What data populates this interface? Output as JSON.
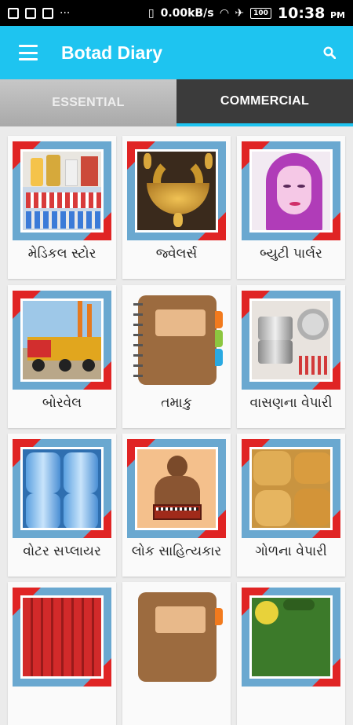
{
  "status": {
    "speed": "0.00kB/s",
    "battery": "100",
    "time": "10:38",
    "ampm": "PM"
  },
  "appbar": {
    "title": "Botad Diary"
  },
  "tabs": [
    {
      "label": "ESSENTIAL",
      "active": false
    },
    {
      "label": "COMMERCIAL",
      "active": true
    }
  ],
  "grid": {
    "items": [
      {
        "label": "મેડિકલ સ્ટોર",
        "icon": "medicine-image"
      },
      {
        "label": "જ્વેલર્સ",
        "icon": "jewellery-image"
      },
      {
        "label": "બ્યુટી પાર્લર",
        "icon": "beauty-face-image"
      },
      {
        "label": "બોરવેલ",
        "icon": "borewell-truck-image"
      },
      {
        "label": "તમાકુ",
        "icon": "diary-book-image"
      },
      {
        "label": "વાસણના વેપારી",
        "icon": "utensils-image"
      },
      {
        "label": "વોટર સપ્લાયર",
        "icon": "water-cans-image"
      },
      {
        "label": "લોક સાહિત્યકાર",
        "icon": "folk-singer-image"
      },
      {
        "label": "ગોળના વેપારી",
        "icon": "jaggery-image"
      },
      {
        "label": "",
        "icon": "gas-cylinders-image"
      },
      {
        "label": "",
        "icon": "diary-book-image"
      },
      {
        "label": "",
        "icon": "vegetables-image"
      }
    ]
  }
}
